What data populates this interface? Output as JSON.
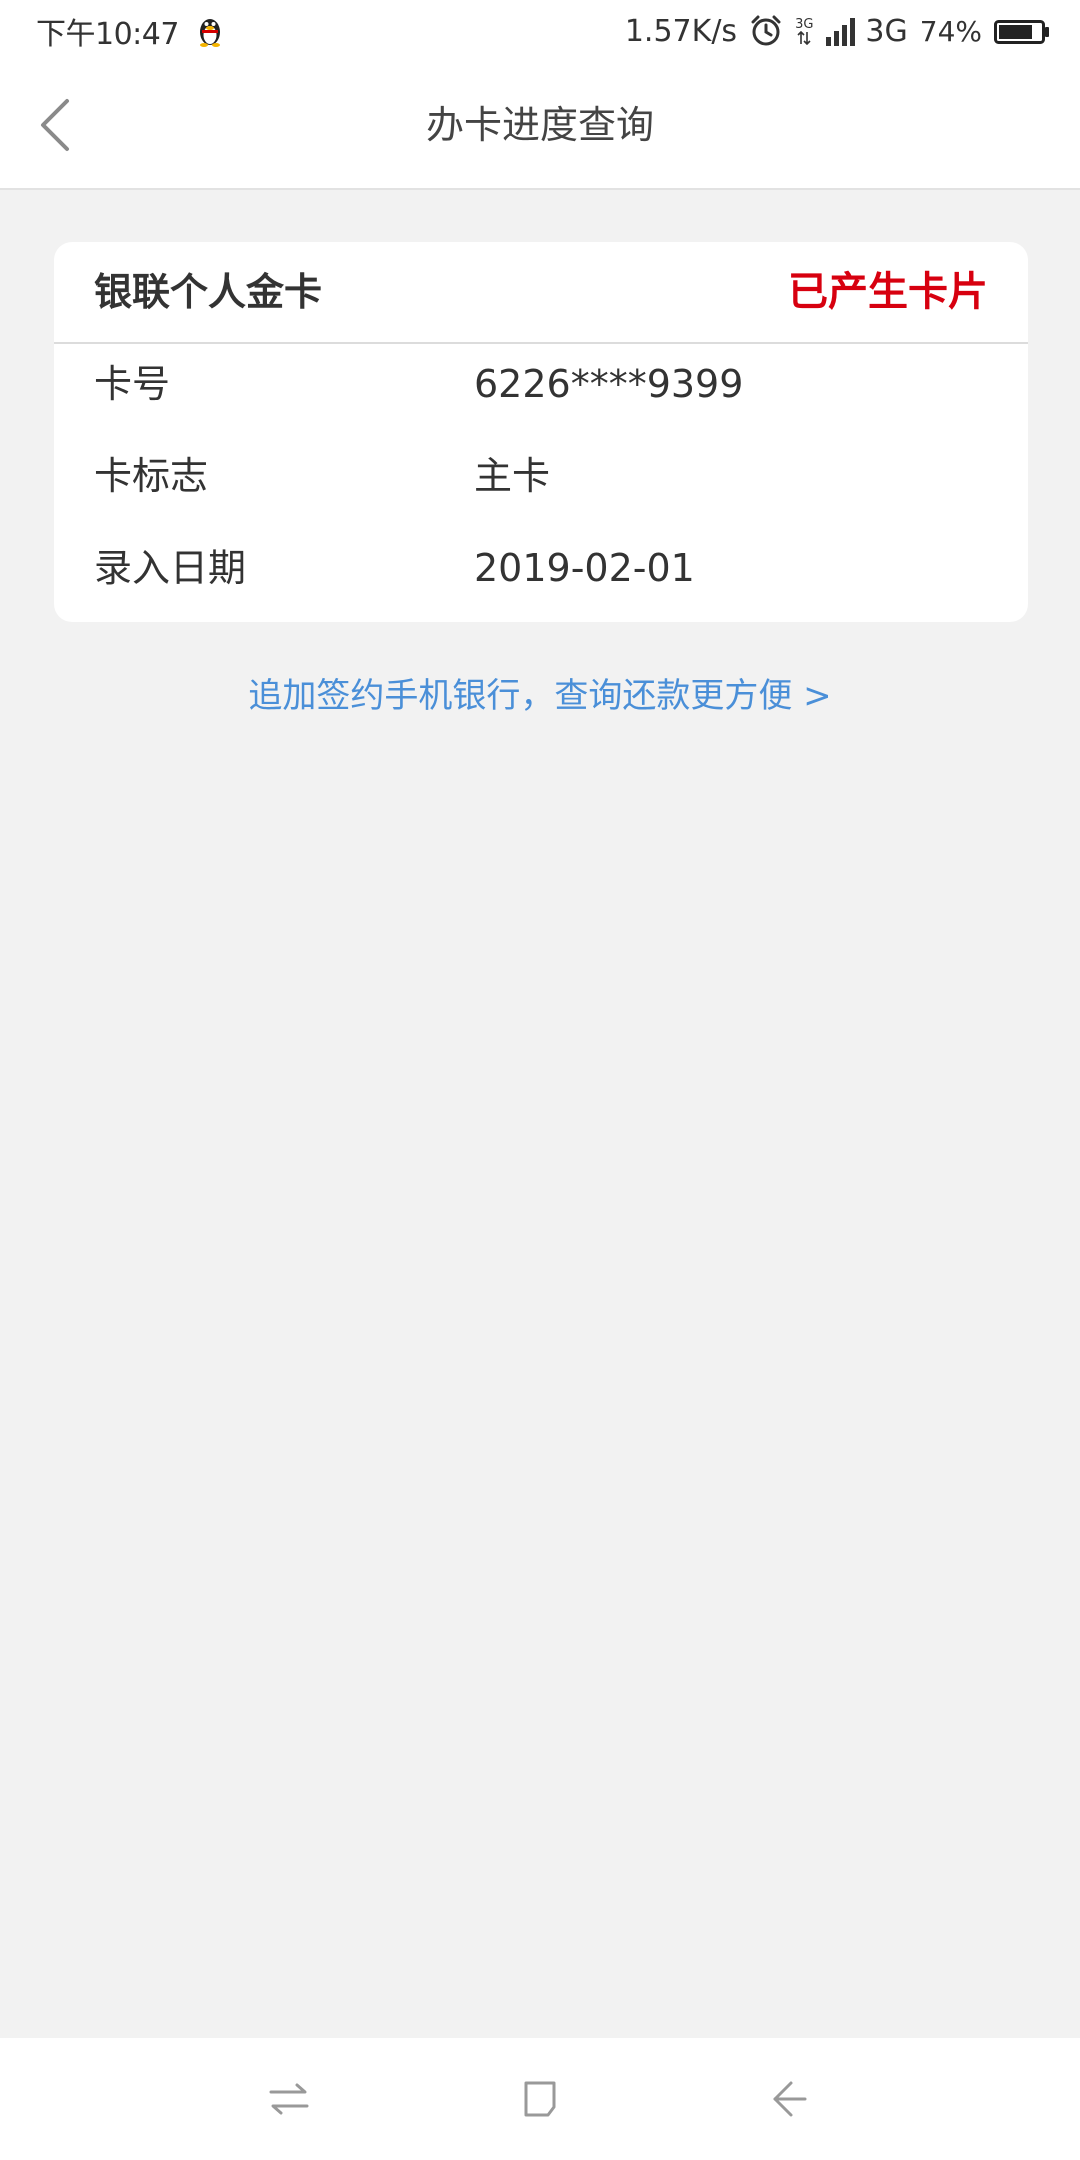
{
  "status_bar": {
    "time": "下午10:47",
    "net_speed": "1.57K/s",
    "net_type_small": "3G",
    "net_type": "3G",
    "battery": "74%"
  },
  "header": {
    "title": "办卡进度查询"
  },
  "card": {
    "type": "银联个人金卡",
    "status": "已产生卡片",
    "status_color": "#d7000f",
    "rows": [
      {
        "label": "卡号",
        "value": "6226****9399"
      },
      {
        "label": "卡标志",
        "value": "主卡"
      },
      {
        "label": "录入日期",
        "value": "2019-02-01"
      }
    ]
  },
  "link": {
    "text": "追加签约手机银行，查询还款更方便 >",
    "color": "#4a8fd8"
  },
  "icons": {
    "back": "chevron-left-icon",
    "nav_recent": "switch-arrows-icon",
    "nav_home": "square-icon",
    "nav_back": "back-arrow-icon"
  }
}
